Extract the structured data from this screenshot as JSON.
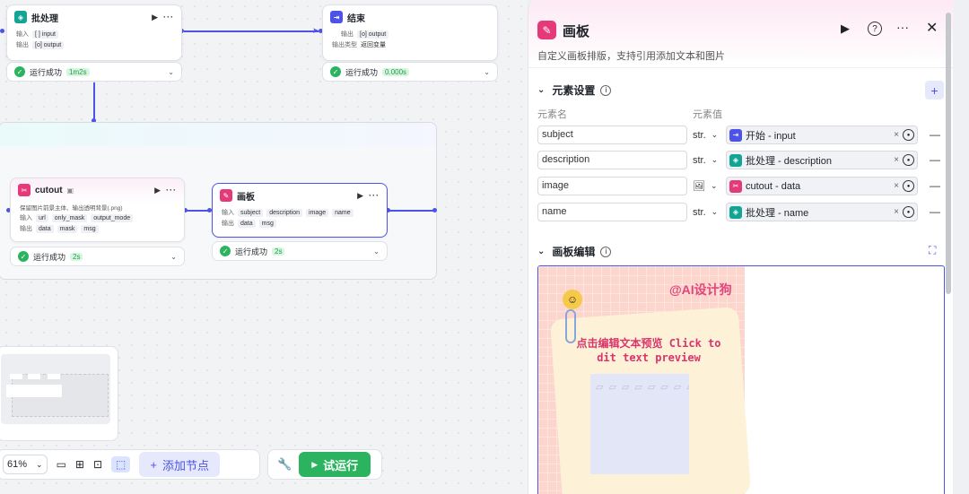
{
  "canvas": {
    "batch_node": {
      "title": "批处理",
      "input_label": "输入",
      "input_chip": "[ ] input",
      "output_label": "输出",
      "output_chip": "[o] output"
    },
    "batch_status": {
      "label": "运行成功",
      "time": "1m2s"
    },
    "end_node": {
      "title": "结束",
      "output_label": "输出",
      "output_chip": "[o] output",
      "output_type_label": "输出类型",
      "output_type_value": "返回变量"
    },
    "end_status": {
      "label": "运行成功",
      "time": "0.000s"
    },
    "cutout_node": {
      "title": "cutout",
      "desc": "保留图片前景主体、输出透明背景(.png)",
      "input_label": "输入",
      "inputs": [
        "url",
        "only_mask",
        "output_mode"
      ],
      "output_label": "输出",
      "outputs": [
        "data",
        "mask",
        "msg"
      ]
    },
    "cutout_status": {
      "label": "运行成功",
      "time": "2s"
    },
    "board_node": {
      "title": "画板",
      "input_label": "输入",
      "inputs": [
        "subject",
        "description",
        "image",
        "name"
      ],
      "output_label": "输出",
      "outputs": [
        "data",
        "msg"
      ]
    },
    "board_status": {
      "label": "运行成功",
      "time": "2s"
    },
    "toolbar": {
      "zoom": "61%",
      "add_node": "添加节点",
      "test_run": "试运行"
    }
  },
  "panel": {
    "title": "画板",
    "description": "自定义画板排版，支持引用添加文本和图片",
    "elements_section": "元素设置",
    "col_name": "元素名",
    "col_value": "元素值",
    "rows": [
      {
        "name": "subject",
        "type": "str.",
        "ref_source": "开始",
        "ref_field": "input",
        "ref_color": "#4d53e8"
      },
      {
        "name": "description",
        "type": "str.",
        "ref_source": "批处理",
        "ref_field": "description",
        "ref_color": "#12a594"
      },
      {
        "name": "image",
        "type": "img",
        "ref_source": "cutout",
        "ref_field": "data",
        "ref_color": "#e5397a"
      },
      {
        "name": "name",
        "type": "str.",
        "ref_source": "批处理",
        "ref_field": "name",
        "ref_color": "#12a594"
      }
    ],
    "edit_section": "画板编辑",
    "preview": {
      "handle": "@AI设计狗",
      "text": "点击编辑文本预览 Click to dit text preview"
    }
  }
}
